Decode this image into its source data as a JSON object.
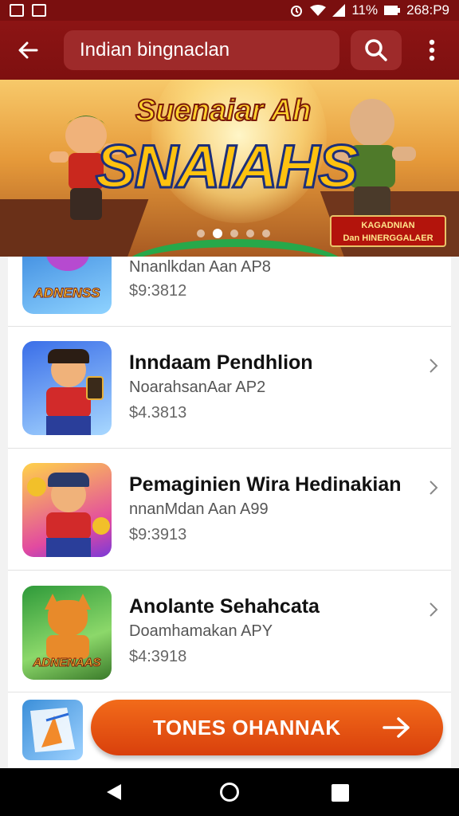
{
  "status_bar": {
    "signal_text": "ᶠ⁄%",
    "battery_text": "11%",
    "time": "268:P9"
  },
  "app_bar": {
    "search_value": "Indian bingnaclan",
    "back_icon": "arrow-left-icon",
    "search_icon": "search-icon",
    "more_icon": "more-vert-icon"
  },
  "banner": {
    "title_top": "Suenaiar Ah",
    "title_main": "SNAIAHS",
    "badge_line1": "KAGADNIAN",
    "badge_line2": "Dan HINERGGALAER",
    "dots": 5,
    "active_dot": 1
  },
  "apps": [
    {
      "title": "",
      "subtitle": "Nnanlkdan Aan AP8",
      "price": "$9:3812",
      "icon_label": "ADNENSS"
    },
    {
      "title": "Inndaam Pendhlion",
      "subtitle": "NoarahsanAar AP2",
      "price": "$4.3813"
    },
    {
      "title": "Pemaginien Wira Hedinakian",
      "subtitle": "nnanMdan Aan A99",
      "price": "$9:3913"
    },
    {
      "title": "Anolante Sehahcata",
      "subtitle": "Doamhamakan APY",
      "price": "$4:3918",
      "icon_label": "ADNENAAS"
    }
  ],
  "cta": {
    "label": "TONES OHANNAK",
    "arrow_icon": "arrow-right-icon"
  },
  "colors": {
    "app_bar": "#8c1414",
    "cta": "#e8521a",
    "badge": "#b3140c"
  }
}
